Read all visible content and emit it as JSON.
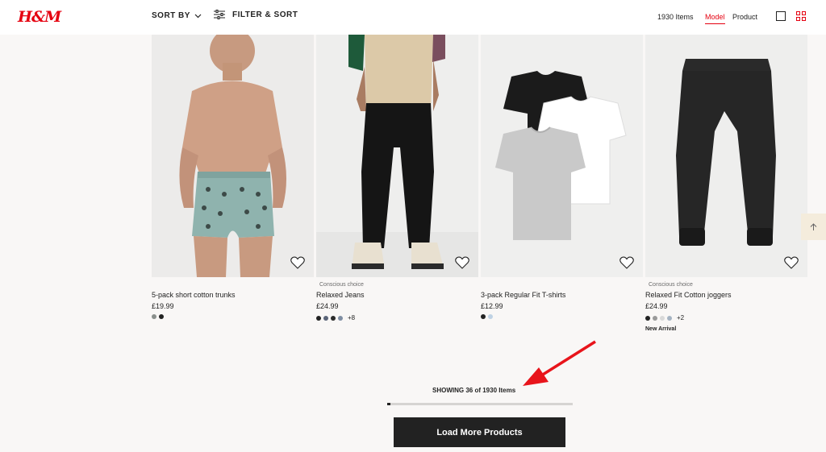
{
  "header": {
    "logo": "H&M",
    "sort_label": "SORT BY",
    "filter_label": "FILTER & SORT",
    "items_count": "1930 Items",
    "view_model": "Model",
    "view_product": "Product",
    "accent_color": "#e50010"
  },
  "products": [
    {
      "tag": "",
      "name": "5-pack short cotton trunks",
      "price": "£19.99",
      "swatches": [
        "#8a8f8c",
        "#222222"
      ],
      "more": "",
      "badge": ""
    },
    {
      "tag": "Conscious choice",
      "name": "Relaxed Jeans",
      "price": "£24.99",
      "swatches": [
        "#222222",
        "#5a6478",
        "#2b2b2b",
        "#7f8ea3"
      ],
      "more": "+8",
      "badge": ""
    },
    {
      "tag": "",
      "name": "3-pack Regular Fit T-shirts",
      "price": "£12.99",
      "swatches": [
        "#222222",
        "#bfd2e4"
      ],
      "more": "",
      "badge": ""
    },
    {
      "tag": "Conscious choice",
      "name": "Relaxed Fit Cotton joggers",
      "price": "£24.99",
      "swatches": [
        "#222222",
        "#9a9a9a",
        "#d9d9d9",
        "#a5b3c2"
      ],
      "more": "+2",
      "badge": "New Arrival"
    }
  ],
  "pagination": {
    "showing": "SHOWING 36 of 1930 Items",
    "progress": 0.0187,
    "load_more": "Load More Products"
  }
}
